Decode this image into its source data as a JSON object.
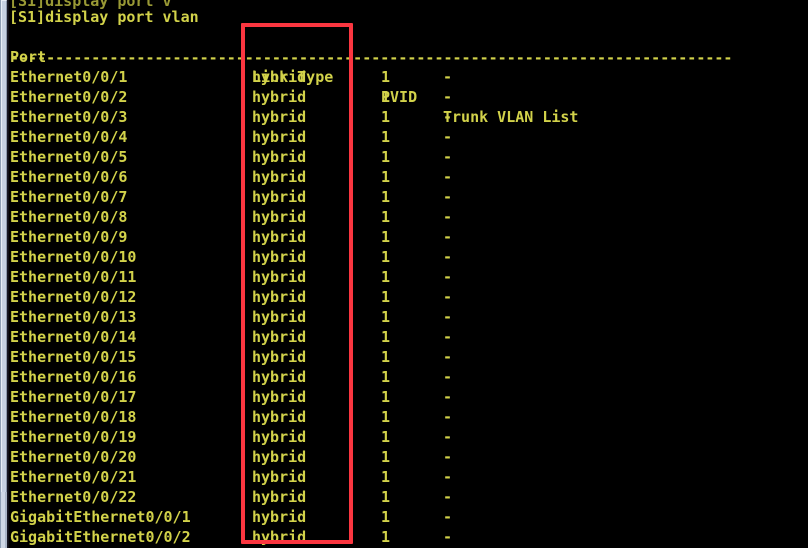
{
  "terminal": {
    "title": "Huawei eNSP switch CLI",
    "background_color": "#000000",
    "text_color": "#d2d24a",
    "highlight_color": "#fb3640",
    "scrollbar_color": "#c6d1e2",
    "clipped_line": "[S1]display port v",
    "command_line": "[S1]display port vlan",
    "divider": "--------------------------------------------------------------------------------",
    "header": {
      "port": "Port",
      "link_type": "Link Type",
      "pvid": "PVID",
      "trunk_vlan_list": "Trunk VLAN List"
    },
    "rows": [
      {
        "port": "Ethernet0/0/1",
        "link_type": "hybrid",
        "pvid": "1",
        "trunk_vlan_list": "-"
      },
      {
        "port": "Ethernet0/0/2",
        "link_type": "hybrid",
        "pvid": "1",
        "trunk_vlan_list": "-"
      },
      {
        "port": "Ethernet0/0/3",
        "link_type": "hybrid",
        "pvid": "1",
        "trunk_vlan_list": "-"
      },
      {
        "port": "Ethernet0/0/4",
        "link_type": "hybrid",
        "pvid": "1",
        "trunk_vlan_list": "-"
      },
      {
        "port": "Ethernet0/0/5",
        "link_type": "hybrid",
        "pvid": "1",
        "trunk_vlan_list": "-"
      },
      {
        "port": "Ethernet0/0/6",
        "link_type": "hybrid",
        "pvid": "1",
        "trunk_vlan_list": "-"
      },
      {
        "port": "Ethernet0/0/7",
        "link_type": "hybrid",
        "pvid": "1",
        "trunk_vlan_list": "-"
      },
      {
        "port": "Ethernet0/0/8",
        "link_type": "hybrid",
        "pvid": "1",
        "trunk_vlan_list": "-"
      },
      {
        "port": "Ethernet0/0/9",
        "link_type": "hybrid",
        "pvid": "1",
        "trunk_vlan_list": "-"
      },
      {
        "port": "Ethernet0/0/10",
        "link_type": "hybrid",
        "pvid": "1",
        "trunk_vlan_list": "-"
      },
      {
        "port": "Ethernet0/0/11",
        "link_type": "hybrid",
        "pvid": "1",
        "trunk_vlan_list": "-"
      },
      {
        "port": "Ethernet0/0/12",
        "link_type": "hybrid",
        "pvid": "1",
        "trunk_vlan_list": "-"
      },
      {
        "port": "Ethernet0/0/13",
        "link_type": "hybrid",
        "pvid": "1",
        "trunk_vlan_list": "-"
      },
      {
        "port": "Ethernet0/0/14",
        "link_type": "hybrid",
        "pvid": "1",
        "trunk_vlan_list": "-"
      },
      {
        "port": "Ethernet0/0/15",
        "link_type": "hybrid",
        "pvid": "1",
        "trunk_vlan_list": "-"
      },
      {
        "port": "Ethernet0/0/16",
        "link_type": "hybrid",
        "pvid": "1",
        "trunk_vlan_list": "-"
      },
      {
        "port": "Ethernet0/0/17",
        "link_type": "hybrid",
        "pvid": "1",
        "trunk_vlan_list": "-"
      },
      {
        "port": "Ethernet0/0/18",
        "link_type": "hybrid",
        "pvid": "1",
        "trunk_vlan_list": "-"
      },
      {
        "port": "Ethernet0/0/19",
        "link_type": "hybrid",
        "pvid": "1",
        "trunk_vlan_list": "-"
      },
      {
        "port": "Ethernet0/0/20",
        "link_type": "hybrid",
        "pvid": "1",
        "trunk_vlan_list": "-"
      },
      {
        "port": "Ethernet0/0/21",
        "link_type": "hybrid",
        "pvid": "1",
        "trunk_vlan_list": "-"
      },
      {
        "port": "Ethernet0/0/22",
        "link_type": "hybrid",
        "pvid": "1",
        "trunk_vlan_list": "-"
      },
      {
        "port": "GigabitEthernet0/0/1",
        "link_type": "hybrid",
        "pvid": "1",
        "trunk_vlan_list": "-"
      },
      {
        "port": "GigabitEthernet0/0/2",
        "link_type": "hybrid",
        "pvid": "1",
        "trunk_vlan_list": "-"
      }
    ]
  }
}
